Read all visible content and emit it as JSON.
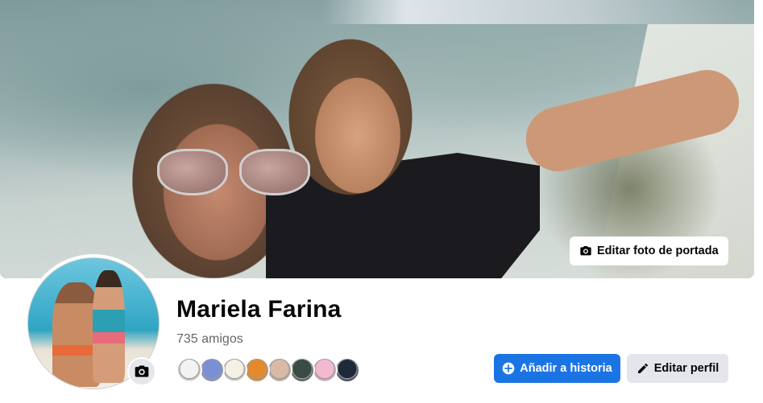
{
  "cover": {
    "edit_cover_label": "Editar foto de portada",
    "icon": "camera-icon"
  },
  "profile": {
    "name": "Mariela Farina",
    "friends_count": "735 amigos",
    "avatar_camera_icon": "camera-icon",
    "friend_avatar_colors": [
      "#f2f2f2",
      "#7a8fd6",
      "#f4f1e4",
      "#e58a2b",
      "#d9b9a8",
      "#3a4a45",
      "#f3b9d1",
      "#1e2a3a"
    ]
  },
  "actions": {
    "add_story_label": "Añadir a historia",
    "add_story_icon": "plus-circle-icon",
    "edit_profile_label": "Editar perfil",
    "edit_profile_icon": "pencil-icon"
  },
  "colors": {
    "primary": "#1b74e4",
    "secondary": "#e4e6eb",
    "text": "#050505",
    "muted": "#65676b"
  }
}
